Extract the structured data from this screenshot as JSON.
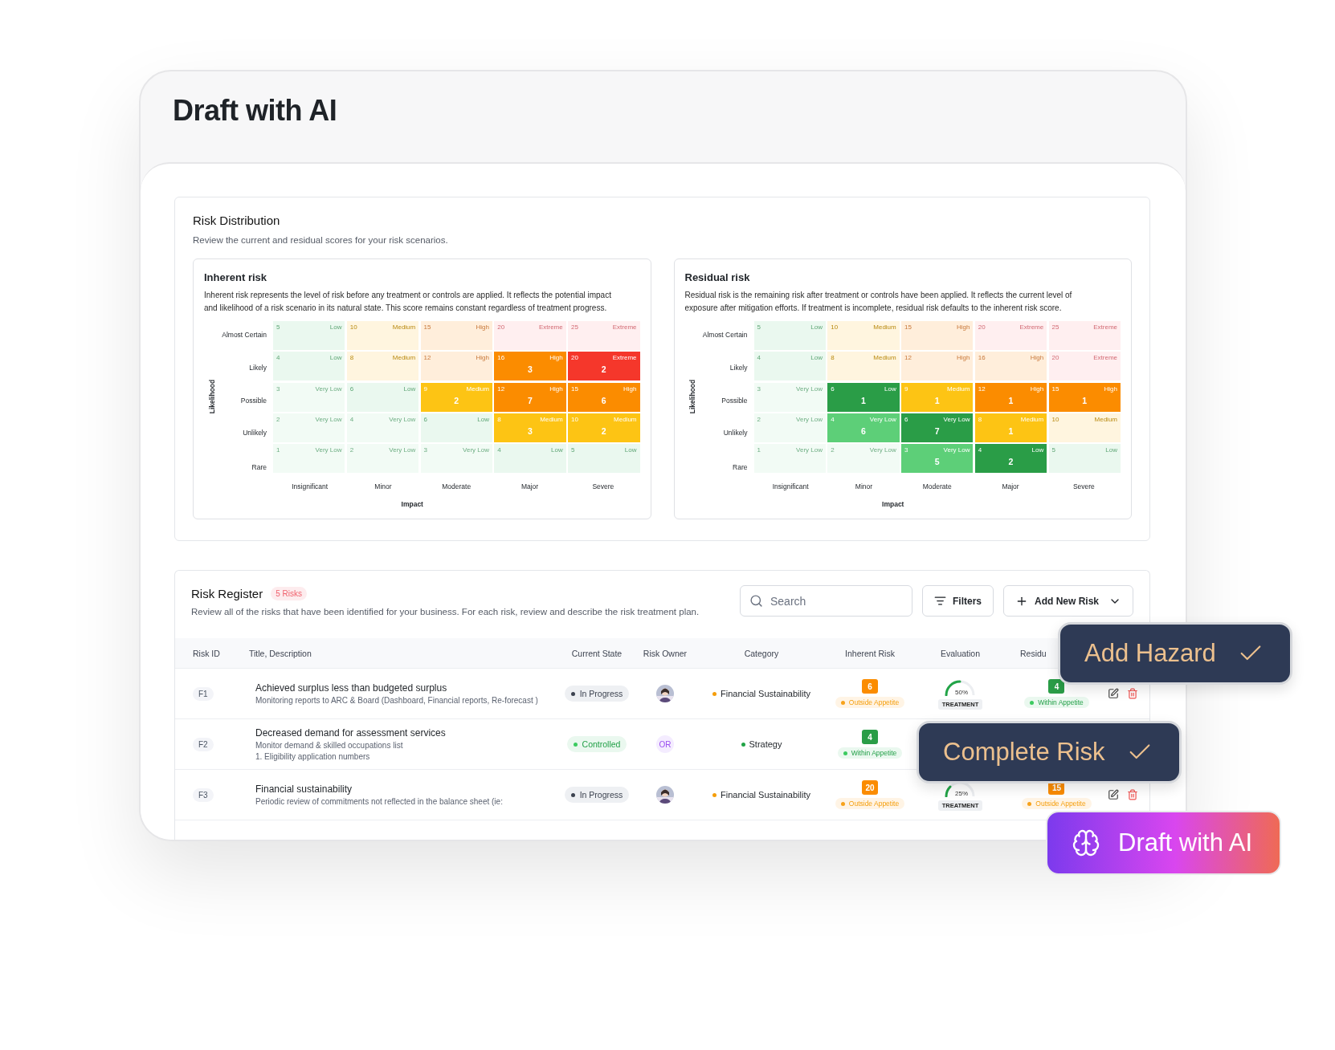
{
  "page": {
    "title": "Draft with AI"
  },
  "distribution": {
    "title": "Risk Distribution",
    "subtitle": "Review the current and residual scores for your risk scenarios.",
    "matrices": [
      {
        "title": "Inherent risk",
        "description": "Inherent risk represents the level of risk before any treatment or controls are applied. It reflects the potential impact and likelihood of a risk scenario in its natural state. This score remains constant regardless of treatment progress.",
        "y_label": "Likelihood",
        "x_label": "Impact",
        "rows": [
          "Almost Certain",
          "Likely",
          "Possible",
          "Unlikely",
          "Rare"
        ],
        "columns": [
          "Insignificant",
          "Minor",
          "Moderate",
          "Major",
          "Severe"
        ],
        "cells": [
          [
            {
              "score": "5",
              "level": "Low",
              "kind": "low",
              "active": false
            },
            {
              "score": "10",
              "level": "Medium",
              "kind": "medium",
              "active": false
            },
            {
              "score": "15",
              "level": "High",
              "kind": "high",
              "active": false
            },
            {
              "score": "20",
              "level": "Extreme",
              "kind": "extreme",
              "active": false
            },
            {
              "score": "25",
              "level": "Extreme",
              "kind": "extreme",
              "active": false
            }
          ],
          [
            {
              "score": "4",
              "level": "Low",
              "kind": "low",
              "active": false
            },
            {
              "score": "8",
              "level": "Medium",
              "kind": "medium",
              "active": false
            },
            {
              "score": "12",
              "level": "High",
              "kind": "high",
              "active": false
            },
            {
              "score": "16",
              "level": "High",
              "kind": "high",
              "active": true,
              "color": "#fb8c00",
              "count": "3"
            },
            {
              "score": "20",
              "level": "Extreme",
              "kind": "extreme",
              "active": true,
              "color": "#f5372b",
              "count": "2"
            }
          ],
          [
            {
              "score": "3",
              "level": "Very Low",
              "kind": "verylow",
              "active": false
            },
            {
              "score": "6",
              "level": "Low",
              "kind": "low",
              "active": false
            },
            {
              "score": "9",
              "level": "Medium",
              "kind": "medium",
              "active": true,
              "color": "#fdc414",
              "count": "2"
            },
            {
              "score": "12",
              "level": "High",
              "kind": "high",
              "active": true,
              "color": "#fb8c00",
              "count": "7"
            },
            {
              "score": "15",
              "level": "High",
              "kind": "high",
              "active": true,
              "color": "#fb8c00",
              "count": "6"
            }
          ],
          [
            {
              "score": "2",
              "level": "Very Low",
              "kind": "verylow",
              "active": false
            },
            {
              "score": "4",
              "level": "Very Low",
              "kind": "verylow",
              "active": false
            },
            {
              "score": "6",
              "level": "Low",
              "kind": "low",
              "active": false
            },
            {
              "score": "8",
              "level": "Medium",
              "kind": "medium",
              "active": true,
              "color": "#fdc414",
              "count": "3"
            },
            {
              "score": "10",
              "level": "Medium",
              "kind": "medium",
              "active": true,
              "color": "#fdc414",
              "count": "2"
            }
          ],
          [
            {
              "score": "1",
              "level": "Very Low",
              "kind": "verylow",
              "active": false
            },
            {
              "score": "2",
              "level": "Very Low",
              "kind": "verylow",
              "active": false
            },
            {
              "score": "3",
              "level": "Very Low",
              "kind": "verylow",
              "active": false
            },
            {
              "score": "4",
              "level": "Low",
              "kind": "low",
              "active": false
            },
            {
              "score": "5",
              "level": "Low",
              "kind": "low",
              "active": false
            }
          ]
        ]
      },
      {
        "title": "Residual risk",
        "description": "Residual risk is the remaining risk after treatment or controls have been applied. It reflects the current level of exposure after mitigation efforts. If treatment is incomplete, residual risk defaults to the inherent risk score.",
        "y_label": "Likelihood",
        "x_label": "Impact",
        "rows": [
          "Almost Certain",
          "Likely",
          "Possible",
          "Unlikely",
          "Rare"
        ],
        "columns": [
          "Insignificant",
          "Minor",
          "Moderate",
          "Major",
          "Severe"
        ],
        "cells": [
          [
            {
              "score": "5",
              "level": "Low",
              "kind": "low",
              "active": false
            },
            {
              "score": "10",
              "level": "Medium",
              "kind": "medium",
              "active": false
            },
            {
              "score": "15",
              "level": "High",
              "kind": "high",
              "active": false
            },
            {
              "score": "20",
              "level": "Extreme",
              "kind": "extreme",
              "active": false
            },
            {
              "score": "25",
              "level": "Extreme",
              "kind": "extreme",
              "active": false
            }
          ],
          [
            {
              "score": "4",
              "level": "Low",
              "kind": "low",
              "active": false
            },
            {
              "score": "8",
              "level": "Medium",
              "kind": "medium",
              "active": false
            },
            {
              "score": "12",
              "level": "High",
              "kind": "high",
              "active": false
            },
            {
              "score": "16",
              "level": "High",
              "kind": "high",
              "active": false
            },
            {
              "score": "20",
              "level": "Extreme",
              "kind": "extreme",
              "active": false
            }
          ],
          [
            {
              "score": "3",
              "level": "Very Low",
              "kind": "verylow",
              "active": false
            },
            {
              "score": "6",
              "level": "Low",
              "kind": "low",
              "active": true,
              "color": "#2a9d47",
              "count": "1"
            },
            {
              "score": "9",
              "level": "Medium",
              "kind": "medium",
              "active": true,
              "color": "#fdc414",
              "count": "1"
            },
            {
              "score": "12",
              "level": "High",
              "kind": "high",
              "active": true,
              "color": "#fb8c00",
              "count": "1"
            },
            {
              "score": "15",
              "level": "High",
              "kind": "high",
              "active": true,
              "color": "#fb8c00",
              "count": "1"
            }
          ],
          [
            {
              "score": "2",
              "level": "Very Low",
              "kind": "verylow",
              "active": false
            },
            {
              "score": "4",
              "level": "Very Low",
              "kind": "verylow",
              "active": true,
              "color": "#5dcf78",
              "count": "6"
            },
            {
              "score": "6",
              "level": "Very Low",
              "kind": "verylow",
              "active": true,
              "color": "#2a9d47",
              "count": "7"
            },
            {
              "score": "8",
              "level": "Medium",
              "kind": "medium",
              "active": true,
              "color": "#fdc414",
              "count": "1"
            },
            {
              "score": "10",
              "level": "Medium",
              "kind": "medium",
              "active": false
            }
          ],
          [
            {
              "score": "1",
              "level": "Very Low",
              "kind": "verylow",
              "active": false
            },
            {
              "score": "2",
              "level": "Very Low",
              "kind": "verylow",
              "active": false
            },
            {
              "score": "3",
              "level": "Very Low",
              "kind": "verylow",
              "active": true,
              "color": "#5dcf78",
              "count": "5"
            },
            {
              "score": "4",
              "level": "Low",
              "kind": "low",
              "active": true,
              "color": "#2a9d47",
              "count": "2"
            },
            {
              "score": "5",
              "level": "Low",
              "kind": "low",
              "active": false
            }
          ]
        ]
      }
    ]
  },
  "register": {
    "title": "Risk Register",
    "count": "5 Risks",
    "subtitle": "Review all of the risks that have been identified for your business. For each risk, review and describe the risk treatment plan.",
    "search": {
      "placeholder": "Search"
    },
    "buttons": [
      {
        "label": "Filters",
        "kind": "filter"
      },
      {
        "label": "Add New Risk",
        "kind": "add"
      }
    ],
    "columns": [
      "Risk ID",
      "Title, Description",
      "Current State",
      "Risk Owner",
      "Category",
      "Inherent Risk",
      "Evaluation",
      "Residu"
    ],
    "rows": [
      {
        "id": "F1",
        "title": "Achieved surplus less than budgeted surplus",
        "description": [
          "Monitoring reports to ARC & Board (Dashboard, Financial reports, Re-forecast )"
        ],
        "state": {
          "label": "In Progress",
          "kind": "progress"
        },
        "owner": {
          "kind": "picture"
        },
        "category": {
          "label": "Financial Sustainability",
          "color": "#f59e0b"
        },
        "inherent": {
          "score": "6",
          "color": "#fb8c00",
          "appetite": "Outside Appetite",
          "kind": "outside"
        },
        "evaluation": {
          "percent": "50%",
          "label": "TREATMENT"
        },
        "residual": {
          "score": "4",
          "color": "#2a9d47",
          "appetite": "Within Appetite",
          "kind": "within"
        },
        "actions": true
      },
      {
        "id": "F2",
        "title": "Decreased demand for assessment services",
        "description": [
          "Monitor demand & skilled occupations list",
          "1. Eligibility application numbers"
        ],
        "state": {
          "label": "Controlled",
          "kind": "controlled"
        },
        "owner": {
          "kind": "initials",
          "text": "OR"
        },
        "category": {
          "label": "Strategy",
          "color": "#22a447"
        },
        "inherent": {
          "score": "4",
          "color": "#2a9d47",
          "appetite": "Within Appetite",
          "kind": "within"
        },
        "actions": false
      },
      {
        "id": "F3",
        "title": "Financial sustainability",
        "description": [
          "Periodic review of commitments not reflected in the balance sheet (ie:"
        ],
        "state": {
          "label": "In Progress",
          "kind": "progress"
        },
        "owner": {
          "kind": "picture"
        },
        "category": {
          "label": "Financial Sustainability",
          "color": "#f59e0b"
        },
        "inherent": {
          "score": "20",
          "color": "#fb8c00",
          "appetite": "Outside Appetite",
          "kind": "outside"
        },
        "evaluation": {
          "percent": "25%",
          "label": "TREATMENT"
        },
        "residual": {
          "score": "15",
          "color": "#fb8c00",
          "appetite": "Outside Appetite",
          "kind": "outside"
        },
        "actions": true
      }
    ]
  },
  "overlay_buttons": [
    {
      "label": "Add Hazard",
      "kind": "check"
    },
    {
      "label": "Complete Risk",
      "kind": "check"
    },
    {
      "label": "Draft with AI",
      "kind": "ai"
    }
  ]
}
